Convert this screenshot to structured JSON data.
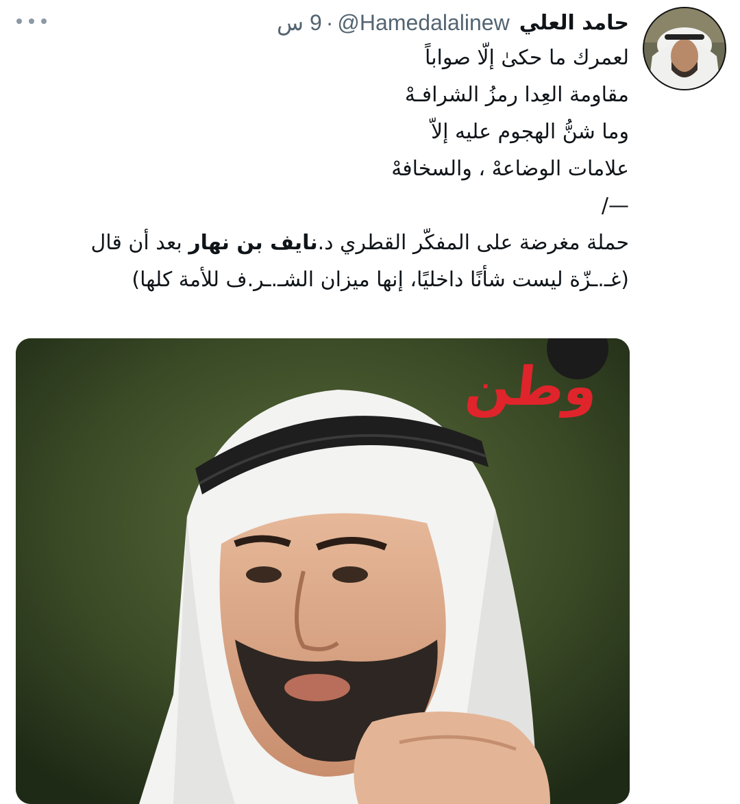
{
  "tweet": {
    "display_name": "حامد العلي",
    "handle": "@Hamedalalinew",
    "separator": "·",
    "time": "9 س",
    "text": {
      "poem_lines": [
        "لعمرك ما حكىٰ إلّا صواباً",
        "مقاومة العِدا رمزُ الشرافـهْ",
        "وما شنُّ الهجوم عليه إلاّ",
        "علامات الوضاعهْ ، والسخافهْ"
      ],
      "divider": "—/",
      "prose_before": "حملة مغرضة على المفكّر القطري د.",
      "prose_bold": "نايف بن نهار",
      "prose_after": " بعد أن قال (غـ.ـزّة ليست شأنًا داخليًا، إنها ميزان الشـ.ـر.ف للأمة كلها)"
    },
    "media": {
      "watermark": "وطن"
    }
  },
  "icons": {
    "more": "more-horizontal-icon"
  }
}
